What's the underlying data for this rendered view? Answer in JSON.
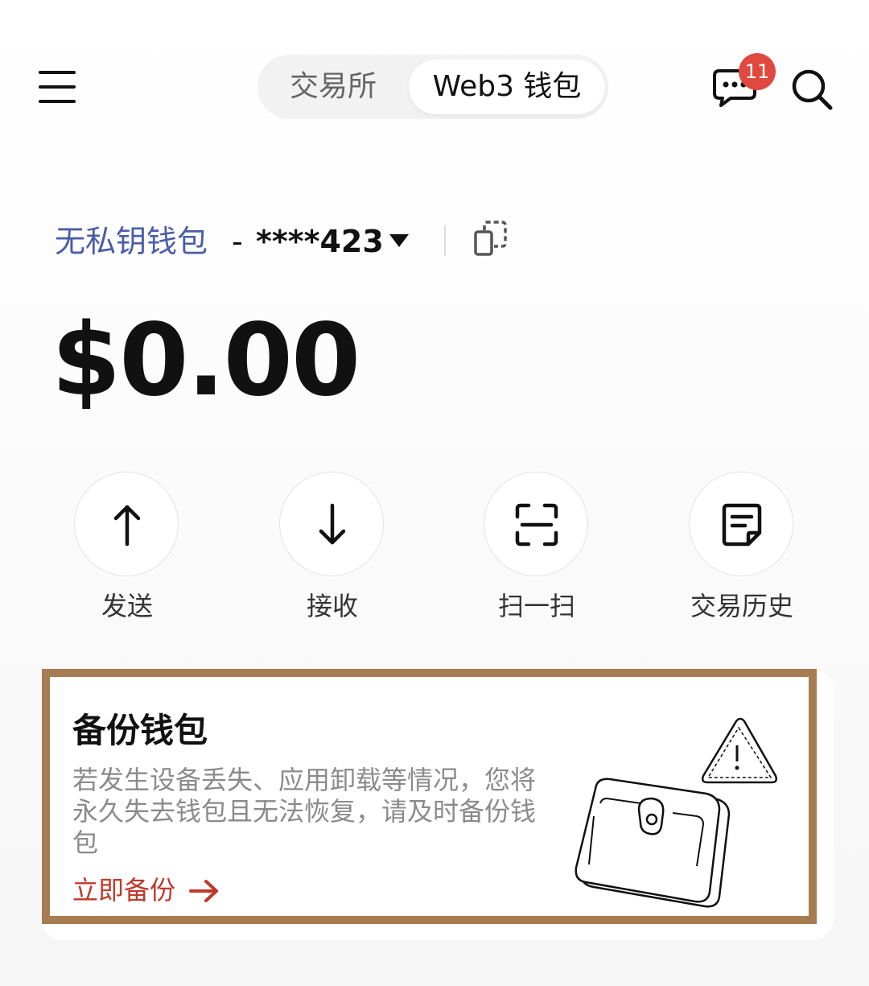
{
  "header": {
    "tabs": [
      {
        "label": "交易所",
        "selected": false
      },
      {
        "label": "Web3 钱包",
        "selected": true
      }
    ],
    "message_badge_count": "11",
    "icons": [
      "menu-icon",
      "chat-icon",
      "search-icon"
    ]
  },
  "wallet": {
    "name": "无私钥钱包",
    "separator": "-",
    "account": "****423",
    "balance": "$0.00"
  },
  "actions": [
    {
      "label": "发送",
      "icon": "arrow-up-icon"
    },
    {
      "label": "接收",
      "icon": "arrow-down-icon"
    },
    {
      "label": "扫一扫",
      "icon": "scan-icon"
    },
    {
      "label": "交易历史",
      "icon": "history-icon"
    }
  ],
  "backup_card": {
    "title": "备份钱包",
    "description": "若发生设备丢失、应用卸载等情况，您将永久失去钱包且无法恢复，请及时备份钱包",
    "link_label": "立即备份",
    "highlight_color": "#a67c52",
    "link_color": "#c0392b"
  },
  "colors": {
    "wallet_name": "#4b5da8",
    "badge": "#e0493f"
  }
}
